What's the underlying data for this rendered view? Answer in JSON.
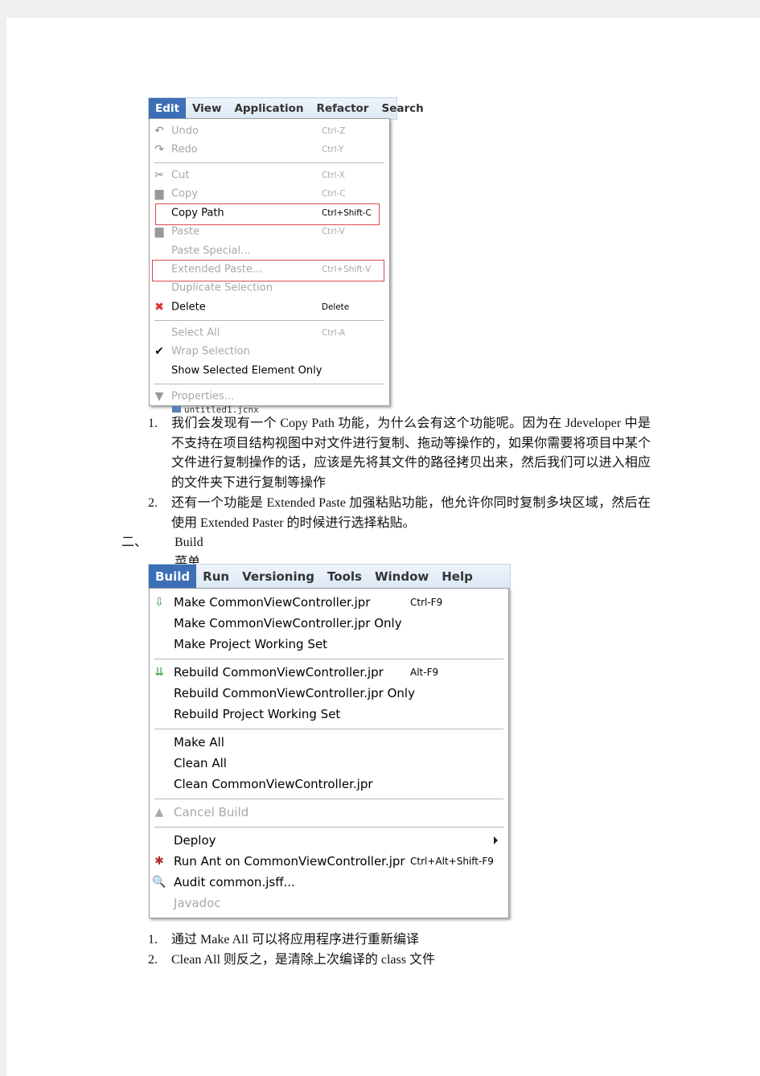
{
  "edit_menu": {
    "menubar": [
      "Edit",
      "View",
      "Application",
      "Refactor",
      "Search"
    ],
    "items": [
      {
        "label": "Undo",
        "shortcut": "Ctrl-Z",
        "disabled": true,
        "icon": "undo-icon"
      },
      {
        "label": "Redo",
        "shortcut": "Ctrl-Y",
        "disabled": true,
        "icon": "redo-icon"
      },
      {
        "separator": true
      },
      {
        "label": "Cut",
        "shortcut": "Ctrl-X",
        "disabled": true,
        "icon": "scissors-icon"
      },
      {
        "label": "Copy",
        "shortcut": "Ctrl-C",
        "disabled": true,
        "icon": "copy-icon"
      },
      {
        "label": "Copy Path",
        "shortcut": "Ctrl+Shift-C",
        "disabled": false,
        "highlight": true
      },
      {
        "label": "Paste",
        "shortcut": "Ctrl-V",
        "disabled": true,
        "icon": "paste-icon"
      },
      {
        "label": "Paste Special...",
        "shortcut": "",
        "disabled": true
      },
      {
        "label": "Extended Paste...",
        "shortcut": "Ctrl+Shift-V",
        "disabled": true,
        "highlight": true
      },
      {
        "label": "Duplicate Selection",
        "shortcut": "",
        "disabled": true
      },
      {
        "label": "Delete",
        "shortcut": "Delete",
        "disabled": false,
        "icon": "delete-x-icon"
      },
      {
        "separator": true
      },
      {
        "label": "Select All",
        "shortcut": "Ctrl-A",
        "disabled": true
      },
      {
        "label": "Wrap Selection",
        "shortcut": "",
        "disabled": true,
        "icon": "checkmark-icon"
      },
      {
        "label": "Show Selected Element Only",
        "shortcut": "",
        "disabled": false
      },
      {
        "separator": true
      },
      {
        "label": "Properties...",
        "shortcut": "",
        "disabled": true,
        "icon": "properties-icon"
      }
    ],
    "below_text": "untitled1.jcnx"
  },
  "paragraphs_1": [
    {
      "num": "1.",
      "text": "我们会发现有一个 Copy  Path 功能，为什么会有这个功能呢。因为在 Jdeveloper 中是不支持在项目结构视图中对文件进行复制、拖动等操作的，如果你需要将项目中某个文件进行复制操作的话，应该是先将其文件的路径拷贝出来，然后我们可以进入相应的文件夹下进行复制等操作"
    },
    {
      "num": "2.",
      "text": "还有一个功能是 Extended Paste 加强粘贴功能，他允许你同时复制多块区域，然后在使用 Extended Paster  的时候进行选择粘贴。"
    }
  ],
  "section_2": {
    "num": "二、",
    "title": "Build 菜单栏中的一些编译操作"
  },
  "build_menu": {
    "menubar": [
      "Build",
      "Run",
      "Versioning",
      "Tools",
      "Window",
      "Help"
    ],
    "items": [
      {
        "label": "Make CommonViewController.jpr",
        "shortcut": "Ctrl-F9",
        "disabled": false,
        "icon": "make-icon"
      },
      {
        "label": "Make CommonViewController.jpr Only",
        "shortcut": "",
        "disabled": false
      },
      {
        "label": "Make Project Working Set",
        "shortcut": "",
        "disabled": false
      },
      {
        "separator": true
      },
      {
        "label": "Rebuild CommonViewController.jpr",
        "shortcut": "Alt-F9",
        "disabled": false,
        "icon": "rebuild-icon"
      },
      {
        "label": "Rebuild CommonViewController.jpr Only",
        "shortcut": "",
        "disabled": false
      },
      {
        "label": "Rebuild Project Working Set",
        "shortcut": "",
        "disabled": false
      },
      {
        "separator": true
      },
      {
        "label": "Make All",
        "shortcut": "",
        "disabled": false
      },
      {
        "label": "Clean All",
        "shortcut": "",
        "disabled": false
      },
      {
        "label": "Clean CommonViewController.jpr",
        "shortcut": "",
        "disabled": false
      },
      {
        "separator": true
      },
      {
        "label": "Cancel Build",
        "shortcut": "",
        "disabled": true,
        "icon": "cancel-build-icon"
      },
      {
        "separator": true
      },
      {
        "label": "Deploy",
        "shortcut": "",
        "disabled": false,
        "submenu": true
      },
      {
        "label": "Run Ant on CommonViewController.jpr",
        "shortcut": "Ctrl+Alt+Shift-F9",
        "disabled": false,
        "icon": "ant-icon"
      },
      {
        "label": "Audit common.jsff...",
        "shortcut": "",
        "disabled": false,
        "icon": "audit-icon"
      },
      {
        "label": "Javadoc",
        "shortcut": "",
        "disabled": true
      }
    ]
  },
  "paragraphs_2": [
    {
      "num": "1.",
      "text": "通过 Make All  可以将应用程序进行重新编译"
    },
    {
      "num": "2.",
      "text": "Clean All 则反之，是清除上次编译的 class 文件"
    }
  ],
  "colors": {
    "menu_active": "#3d6fb6",
    "highlight_box": "#e0474c",
    "disabled_text": "#a8a8a8"
  }
}
